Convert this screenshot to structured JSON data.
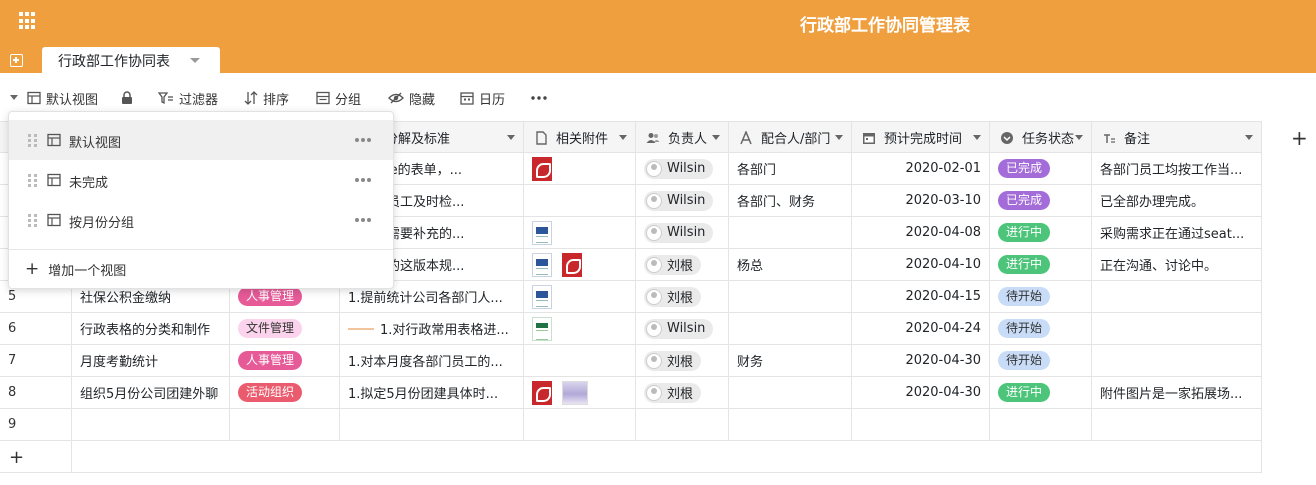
{
  "header": {
    "app_title": "行政部工作协同管理表",
    "table_tab": "行政部工作协同表",
    "accent": "#f09f3f"
  },
  "toolbar": {
    "view_name": "默认视图",
    "filter": "过滤器",
    "sort": "排序",
    "group": "分组",
    "hide": "隐藏",
    "calendar": "日历"
  },
  "views_menu": {
    "items": [
      "默认视图",
      "未完成",
      "按月份分组"
    ],
    "add_view": "增加一个视图"
  },
  "columns": [
    {
      "name": "务分解及标准",
      "icon": "long-text-icon"
    },
    {
      "name": "相关附件",
      "icon": "file-icon"
    },
    {
      "name": "负责人",
      "icon": "collaborator-icon"
    },
    {
      "name": "配合人/部门",
      "icon": "text-icon"
    },
    {
      "name": "预计完成时间",
      "icon": "date-icon"
    },
    {
      "name": "任务状态",
      "icon": "single-select-icon"
    },
    {
      "name": "备注",
      "icon": "long-text-icon"
    }
  ],
  "rows": [
    {
      "num": "",
      "task": "",
      "category": "",
      "desc": "eaTable的表单，...",
      "files": [
        "pdf"
      ],
      "owner": "Wilsin",
      "partner": "各部门",
      "date": "2020-02-01",
      "status": "已完成",
      "note": "各部门员工均按工作当..."
    },
    {
      "num": "",
      "task": "",
      "category": "",
      "desc": "各部门员工及时检...",
      "files": [],
      "owner": "Wilsin",
      "partner": "各部门、财务",
      "date": "2020-03-10",
      "status": "已完成",
      "note": "已全部办理完成。"
    },
    {
      "num": "",
      "task": "",
      "category": "",
      "desc": "各部门需要补充的...",
      "files": [
        "doc"
      ],
      "owner": "Wilsin",
      "partner": "",
      "date": "2020-04-08",
      "status": "进行中",
      "note": "采购需求正在通过seat..."
    },
    {
      "num": "",
      "task": "",
      "category": "",
      "desc": "司目前的这版本规...",
      "files": [
        "doc",
        "pdf"
      ],
      "owner": "刘根",
      "partner": "杨总",
      "date": "2020-04-10",
      "status": "进行中",
      "note": "正在沟通、讨论中。"
    },
    {
      "num": "5",
      "task": "社保公积金缴纳",
      "category": "人事管理",
      "desc": "1.提前统计公司各部门人...",
      "files": [
        "doc"
      ],
      "owner": "刘根",
      "partner": "",
      "date": "2020-04-15",
      "status": "待开始",
      "note": ""
    },
    {
      "num": "6",
      "task": "行政表格的分类和制作",
      "category": "文件管理",
      "desc": "1.对行政常用表格进...",
      "files": [
        "xls"
      ],
      "owner": "Wilsin",
      "partner": "",
      "date": "2020-04-24",
      "status": "待开始",
      "note": ""
    },
    {
      "num": "7",
      "task": "月度考勤统计",
      "category": "人事管理",
      "desc": "1.对本月度各部门员工的...",
      "files": [],
      "owner": "刘根",
      "partner": "财务",
      "date": "2020-04-30",
      "status": "待开始",
      "note": ""
    },
    {
      "num": "8",
      "task": "组织5月份公司团建外聊",
      "category": "活动组织",
      "desc": "1.拟定5月份团建具体时...",
      "files": [
        "pdf",
        "img"
      ],
      "owner": "刘根",
      "partner": "",
      "date": "2020-04-30",
      "status": "进行中",
      "note": "附件图片是一家拓展场..."
    },
    {
      "num": "9",
      "task": "",
      "category": "",
      "desc": "",
      "files": [],
      "owner": "",
      "partner": "",
      "date": "",
      "status": "",
      "note": ""
    }
  ],
  "add_row": "+",
  "add_column": "+",
  "colors": {
    "status_done": "#a36cd9",
    "status_progress": "#4cc47a",
    "status_todo": "#c8dcf8",
    "cat_hr": "#e65a98",
    "cat_file": "#fbd3ec",
    "cat_event": "#ea5b6d"
  }
}
